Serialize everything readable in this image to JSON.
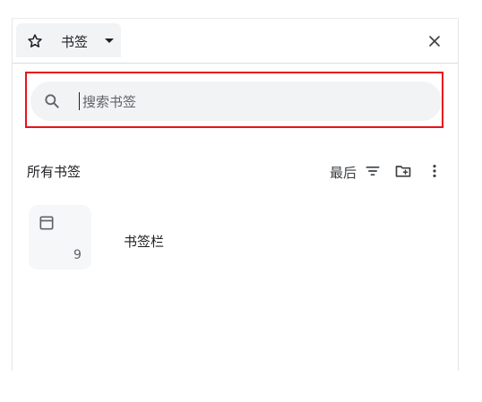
{
  "header": {
    "tab_label": "书签",
    "star_icon": "star-icon",
    "dropdown_icon": "caret-down-icon",
    "close_icon": "close-icon"
  },
  "search": {
    "placeholder": "搜索书签",
    "value": "",
    "icon": "search-icon",
    "highlight_color": "#e8121c"
  },
  "bookmarks": {
    "section_title": "所有书签",
    "sort_label": "最后",
    "sort_icon": "sort-icon",
    "new_folder_icon": "new-folder-icon",
    "more_icon": "more-vert-icon",
    "items": [
      {
        "name": "书签栏",
        "count": "9",
        "icon": "bookmark-bar-icon"
      }
    ]
  }
}
